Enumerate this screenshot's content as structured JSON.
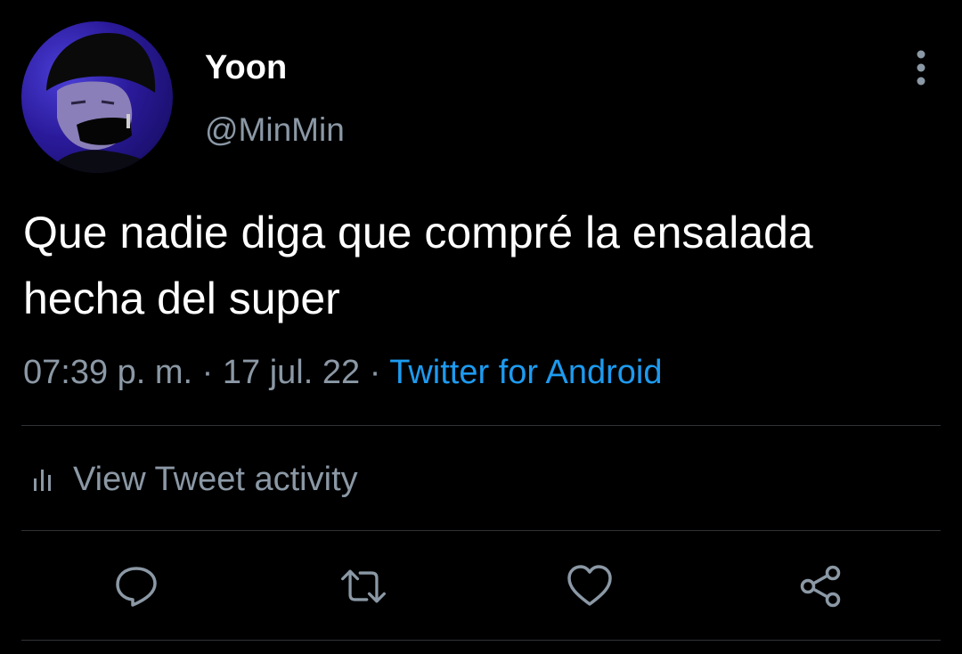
{
  "user": {
    "display_name": "Yoon",
    "handle": "@MinMin",
    "avatar": "profile-photo"
  },
  "tweet": {
    "text_line1": "Que nadie diga que compré la ensalada",
    "text_line2": "hecha del super",
    "time": "07:39 p. m.",
    "separator1": " · ",
    "date": "17 jul. 22",
    "separator2": " · ",
    "source": "Twitter for Android"
  },
  "activity": {
    "label": "View Tweet activity",
    "icon": "bar-chart-icon"
  },
  "actions": {
    "reply_icon": "reply-icon",
    "retweet_icon": "retweet-icon",
    "like_icon": "heart-icon",
    "share_icon": "share-icon"
  },
  "menu": {
    "icon": "more-vertical-icon"
  },
  "colors": {
    "background": "#000000",
    "text": "#ffffff",
    "secondary": "#8b98a5",
    "link": "#1d9bf0",
    "divider": "#2f3336"
  }
}
